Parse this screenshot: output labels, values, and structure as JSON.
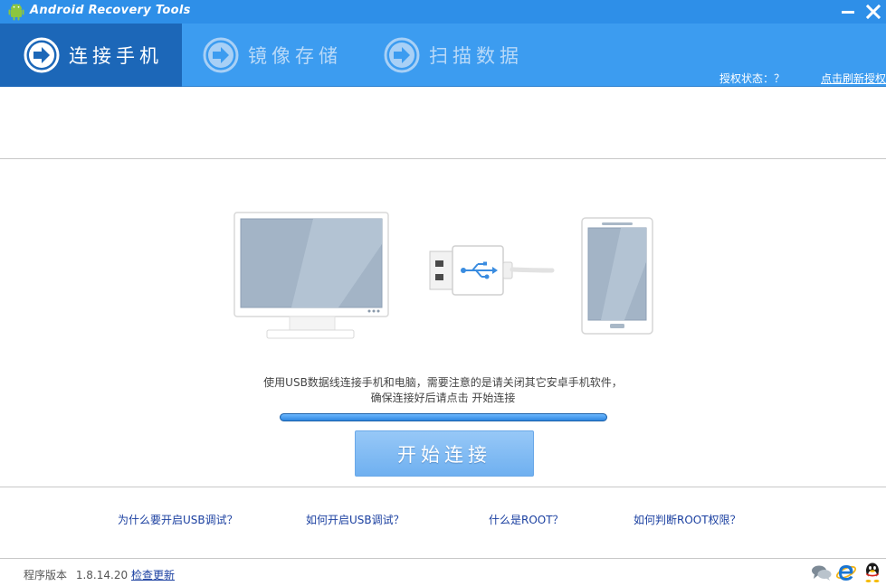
{
  "window": {
    "title": "Android Recovery Tools",
    "logo_icon": "android-logo-icon",
    "minimize_icon": "minimize-icon",
    "close_icon": "close-icon"
  },
  "tabs": [
    {
      "label": "连接手机",
      "active": true,
      "icon": "arrow-right-circle-icon"
    },
    {
      "label": "镜像存储",
      "active": false,
      "icon": "arrow-right-circle-icon"
    },
    {
      "label": "扫描数据",
      "active": false,
      "icon": "arrow-right-circle-icon"
    }
  ],
  "auth": {
    "status_label": "授权状态：？",
    "refresh_link": "点击刷新授权"
  },
  "main": {
    "illustration_icons": [
      "monitor-icon",
      "usb-connector-icon",
      "phone-icon"
    ],
    "instruction_line1": "使用USB数据线连接手机和电脑，需要注意的是请关闭其它安卓手机软件，",
    "instruction_line2": "确保连接好后请点击 开始连接",
    "progress": 1.0,
    "start_button": "开始连接"
  },
  "help_links": [
    "为什么要开启USB调试？",
    "如何开启USB调试？",
    "什么是ROOT？",
    "如何判断ROOT权限？"
  ],
  "footer": {
    "version_label": "程序版本",
    "version_value": "1.8.14.20",
    "check_update": "检查更新",
    "icons": [
      "chat-bubbles-icon",
      "ie-icon",
      "qq-penguin-icon"
    ]
  },
  "colors": {
    "title_bar": "#2e8fe8",
    "tab_band": "#3c9cf0",
    "active_tab": "#1c67b8",
    "link": "#1a3fa0",
    "button": "#7fbaf3"
  }
}
